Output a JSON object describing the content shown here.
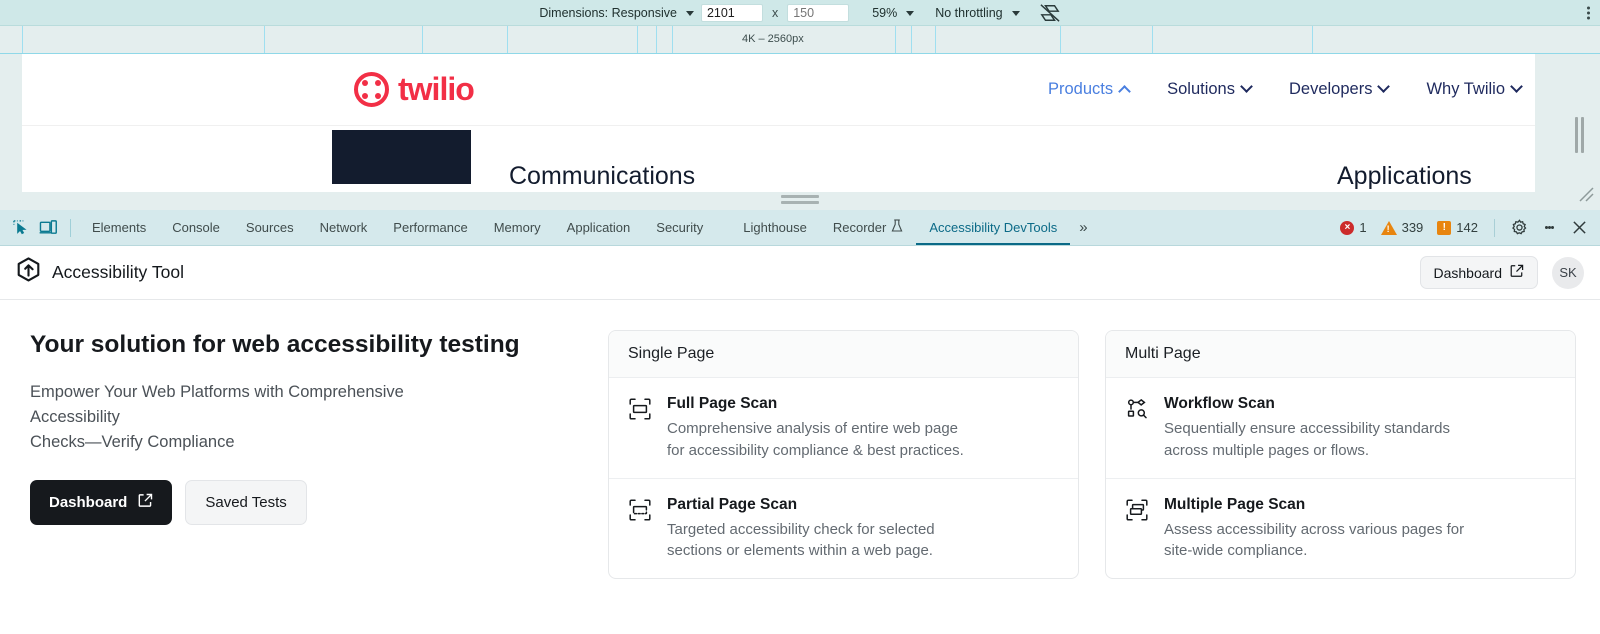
{
  "device_bar": {
    "dimensions_label": "Dimensions: Responsive",
    "width_value": "2101",
    "height_placeholder": "150",
    "zoom_label": "59%",
    "throttling_label": "No throttling",
    "rotate_icon": "rotate-device-icon",
    "menu_icon": "more-options-icon"
  },
  "ruler": {
    "marker_label": "4K – 2560px"
  },
  "page_preview": {
    "brand": "twilio",
    "nav_items": [
      {
        "label": "Products",
        "chevron": "up",
        "active": true
      },
      {
        "label": "Solutions",
        "chevron": "down",
        "active": false
      },
      {
        "label": "Developers",
        "chevron": "down",
        "active": false
      },
      {
        "label": "Why Twilio",
        "chevron": "down",
        "active": false
      }
    ],
    "hero_text_left": "Communications",
    "hero_text_right": "Applications"
  },
  "devtools": {
    "inspect_icon": "inspect-element-icon",
    "device_toggle_icon": "device-toolbar-icon",
    "tabs": [
      {
        "label": "Elements",
        "selected": false
      },
      {
        "label": "Console",
        "selected": false
      },
      {
        "label": "Sources",
        "selected": false
      },
      {
        "label": "Network",
        "selected": false
      },
      {
        "label": "Performance",
        "selected": false
      },
      {
        "label": "Memory",
        "selected": false
      },
      {
        "label": "Application",
        "selected": false
      },
      {
        "label": "Security",
        "selected": false
      },
      {
        "label": "Lighthouse",
        "selected": false
      },
      {
        "label": "Recorder",
        "selected": false,
        "icon": "experiment-flask-icon"
      },
      {
        "label": "Accessibility DevTools",
        "selected": true
      }
    ],
    "more_tabs_label": "»",
    "counters": {
      "errors": "1",
      "warnings": "339",
      "infos": "142"
    },
    "settings_icon": "gear-icon",
    "menu_icon": "more-options-icon",
    "close_icon": "close-icon"
  },
  "extension": {
    "logo_icon": "accessibility-tool-logo-icon",
    "name": "Accessibility Tool",
    "dashboard_button": "Dashboard",
    "dashboard_icon": "external-link-icon",
    "avatar_initials": "SK",
    "hero": {
      "title": "Your solution for web accessibility testing",
      "subtitle_line1": "Empower Your Web Platforms with Comprehensive",
      "subtitle_line2": "Accessibility",
      "subtitle_line3": "Checks—Verify Compliance",
      "primary_button": "Dashboard",
      "primary_button_icon": "external-link-icon",
      "secondary_button": "Saved Tests"
    },
    "cards": [
      {
        "heading": "Single Page",
        "items": [
          {
            "icon": "full-page-scan-icon",
            "title": "Full Page Scan",
            "desc_line1": "Comprehensive analysis of entire web page",
            "desc_line2": "for accessibility compliance & best practices."
          },
          {
            "icon": "partial-page-scan-icon",
            "title": "Partial Page Scan",
            "desc_line1": "Targeted accessibility check for selected",
            "desc_line2": "sections or elements within a web page."
          }
        ]
      },
      {
        "heading": "Multi Page",
        "items": [
          {
            "icon": "workflow-scan-icon",
            "title": "Workflow Scan",
            "desc_line1": "Sequentially ensure accessibility standards",
            "desc_line2": "across multiple pages or flows."
          },
          {
            "icon": "multiple-page-scan-icon",
            "title": "Multiple Page Scan",
            "desc_line1": "Assess accessibility across various pages for",
            "desc_line2": "site-wide compliance."
          }
        ]
      }
    ]
  },
  "colors": {
    "devtools_bg": "#d5e9ec",
    "accent_tab": "#0b6a87",
    "twilio_red": "#F22F46",
    "error_red": "#cc2b2b",
    "warning_orange": "#e8850f",
    "dark_button": "#16191d"
  }
}
